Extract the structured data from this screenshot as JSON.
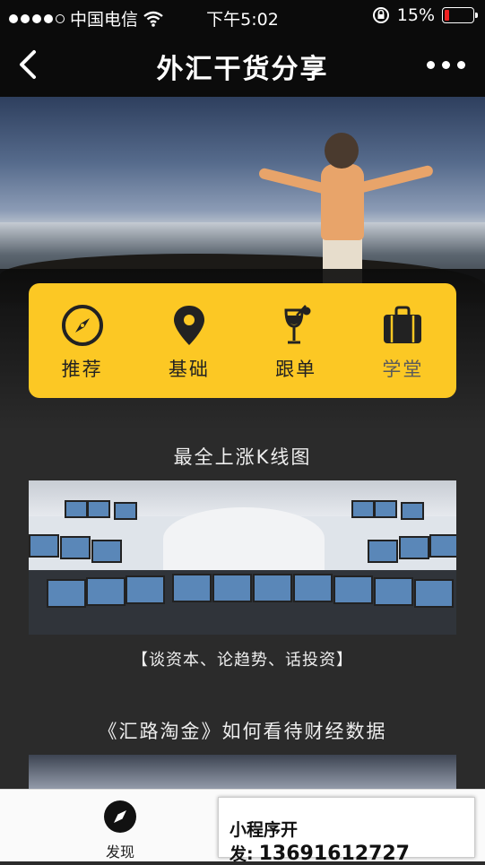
{
  "status": {
    "carrier": "中国电信",
    "time": "下午5:02",
    "battery": "15%"
  },
  "nav": {
    "title": "外汇干货分享"
  },
  "menu": [
    {
      "label": "推荐",
      "icon": "compass-icon"
    },
    {
      "label": "基础",
      "icon": "location-pin-icon"
    },
    {
      "label": "跟单",
      "icon": "cocktail-icon"
    },
    {
      "label": "学堂",
      "icon": "briefcase-icon"
    }
  ],
  "articles": [
    {
      "title": "最全上涨K线图",
      "caption": "【谈资本、论趋势、话投资】"
    },
    {
      "title": "《汇路淘金》如何看待财经数据"
    }
  ],
  "tabbar": {
    "discover_label": "发现"
  },
  "ad": {
    "label": "小程序开发:",
    "phone": "13691612727"
  },
  "colors": {
    "accent": "#fcc824",
    "background": "#2b2b2b"
  }
}
